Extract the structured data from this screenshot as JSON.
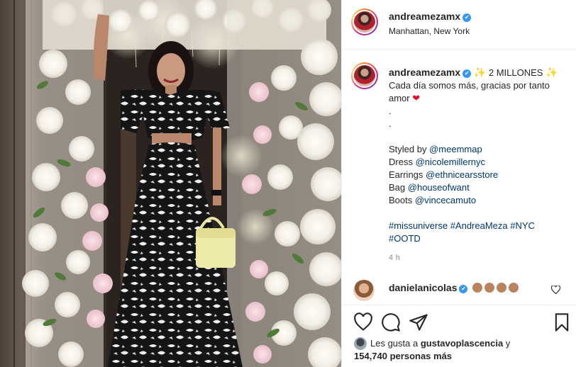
{
  "post": {
    "username": "andreamezamx",
    "location": "Manhattan, New York",
    "verified_glyph": "✔"
  },
  "caption": {
    "username": "andreamezamx",
    "headline": "2 MILLONES",
    "line1": "Cada día somos más, gracias por tanto",
    "line2": "amor",
    "dot1": ".",
    "dot2": ".",
    "styled_label": "Styled by",
    "styled_handle": "@meemmap",
    "dress_label": "Dress",
    "dress_handle": "@nicolemillernyc",
    "earrings_label": "Earrings",
    "earrings_handle": "@ethnicearsstore",
    "bag_label": "Bag",
    "bag_handle": "@houseofwant",
    "boots_label": "Boots",
    "boots_handle": "@vincecamuto",
    "hashtags1": "#missuniverse #AndreaMeza #NYC",
    "hashtags2": "#OOTD",
    "time": "4 h"
  },
  "comment": {
    "username": "danielanicolas",
    "emoji_count": 4
  },
  "likes": {
    "prefix": "Les gusta a",
    "user": "gustavoplascencia",
    "and": "y",
    "count": "154,740 personas más"
  },
  "icons": {
    "like": "heart-outline-icon",
    "comment": "speech-bubble-icon",
    "share": "paper-plane-icon",
    "save": "bookmark-icon",
    "verified": "verified-badge-icon",
    "sparkles": "sparkles-icon",
    "red_heart": "red-heart-icon"
  },
  "colors": {
    "link": "#00376b",
    "verified": "#3897f0",
    "muted": "#8e8e8e",
    "heart": "#e0102a"
  }
}
